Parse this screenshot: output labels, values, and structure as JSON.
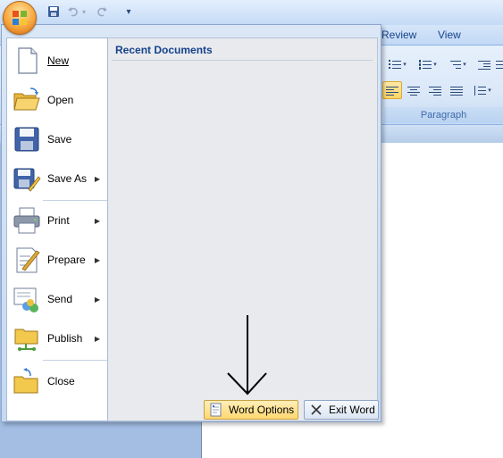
{
  "ribbon": {
    "tabs": [
      "Review",
      "View"
    ],
    "group_label": "Paragraph"
  },
  "qat": {
    "customize_glyph": "▾"
  },
  "office_menu": {
    "items": [
      {
        "label": "New",
        "icon": "new-document-icon",
        "submenu": false
      },
      {
        "label": "Open",
        "icon": "open-folder-icon",
        "submenu": false
      },
      {
        "label": "Save",
        "icon": "save-icon",
        "submenu": false
      },
      {
        "label": "Save As",
        "icon": "save-as-icon",
        "submenu": true
      },
      {
        "label": "Print",
        "icon": "printer-icon",
        "submenu": true
      },
      {
        "label": "Prepare",
        "icon": "prepare-icon",
        "submenu": true
      },
      {
        "label": "Send",
        "icon": "send-icon",
        "submenu": true
      },
      {
        "label": "Publish",
        "icon": "publish-icon",
        "submenu": true
      },
      {
        "label": "Close",
        "icon": "close-folder-icon",
        "submenu": false
      }
    ],
    "recent_title": "Recent Documents",
    "footer": {
      "options_label": "Word Options",
      "exit_label": "Exit Word"
    }
  },
  "colors": {
    "accent": "#15428b",
    "highlight": "#ffd770"
  }
}
